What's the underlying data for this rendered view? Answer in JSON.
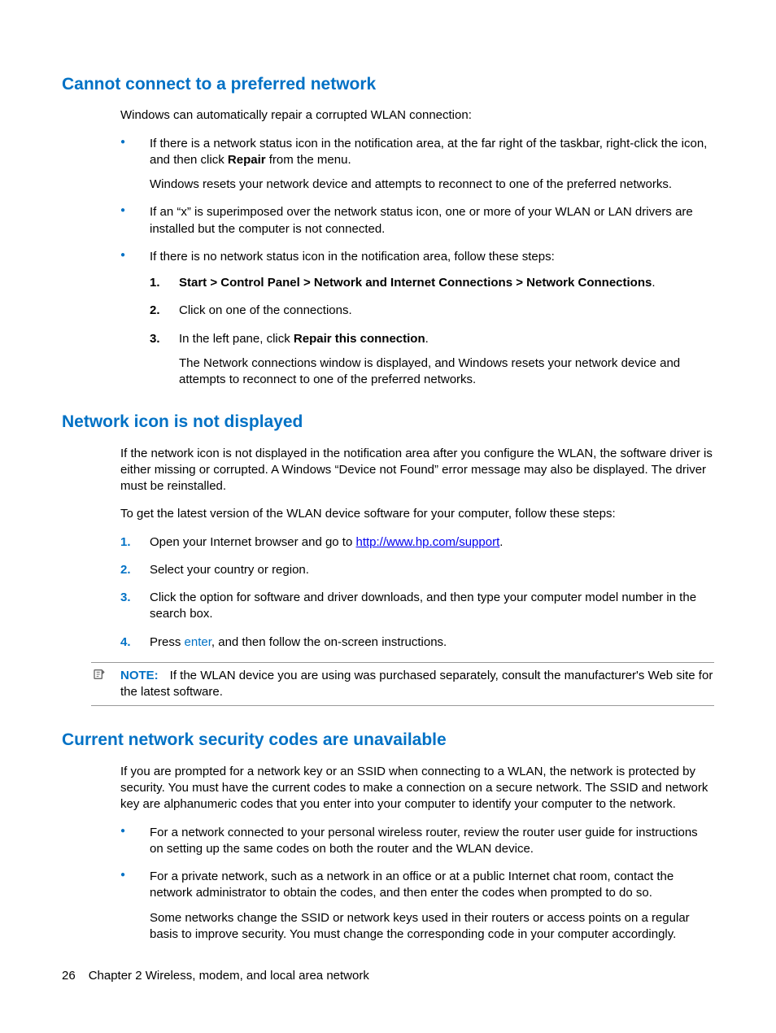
{
  "section1": {
    "title": "Cannot connect to a preferred network",
    "intro": "Windows can automatically repair a corrupted WLAN connection:",
    "bullet1a": "If there is a network status icon in the notification area, at the far right of the taskbar, right-click the icon, and then click ",
    "bullet1bold": "Repair",
    "bullet1b": " from the menu.",
    "bullet1sub": "Windows resets your network device and attempts to reconnect to one of the preferred networks.",
    "bullet2": "If an “x” is superimposed over the network status icon, one or more of your WLAN or LAN drivers are installed but the computer is not connected.",
    "bullet3": "If there is no network status icon in the notification area, follow these steps:",
    "step1a": "Start > Control Panel > Network and Internet Connections > Network Connections",
    "step1b": ".",
    "step2": "Click on one of the connections.",
    "step3a": "In the left pane, click ",
    "step3bold": "Repair this connection",
    "step3b": ".",
    "step3sub": "The Network connections window is displayed, and Windows resets your network device and attempts to reconnect to one of the preferred networks."
  },
  "section2": {
    "title": "Network icon is not displayed",
    "p1": "If the network icon is not displayed in the notification area after you configure the WLAN, the software driver is either missing or corrupted. A Windows “Device not Found” error message may also be displayed. The driver must be reinstalled.",
    "p2": "To get the latest version of the WLAN device software for your computer, follow these steps:",
    "step1a": "Open your Internet browser and go to ",
    "step1link": "http://www.hp.com/support",
    "step1b": ".",
    "step2": "Select your country or region.",
    "step3": "Click the option for software and driver downloads, and then type your computer model number in the search box.",
    "step4a": "Press ",
    "step4kw": "enter",
    "step4b": ", and then follow the on-screen instructions.",
    "note_label": "NOTE:",
    "note_text": "If the WLAN device you are using was purchased separately, consult the manufacturer's Web site for the latest software."
  },
  "section3": {
    "title": "Current network security codes are unavailable",
    "p1": "If you are prompted for a network key or an SSID when connecting to a WLAN, the network is protected by security. You must have the current codes to make a connection on a secure network. The SSID and network key are alphanumeric codes that you enter into your computer to identify your computer to the network.",
    "bullet1": "For a network connected to your personal wireless router, review the router user guide for instructions on setting up the same codes on both the router and the WLAN device.",
    "bullet2": "For a private network, such as a network in an office or at a public Internet chat room, contact the network administrator to obtain the codes, and then enter the codes when prompted to do so.",
    "bullet2sub": "Some networks change the SSID or network keys used in their routers or access points on a regular basis to improve security. You must change the corresponding code in your computer accordingly."
  },
  "footer": {
    "page": "26",
    "chapter": "Chapter 2   Wireless, modem, and local area network"
  }
}
